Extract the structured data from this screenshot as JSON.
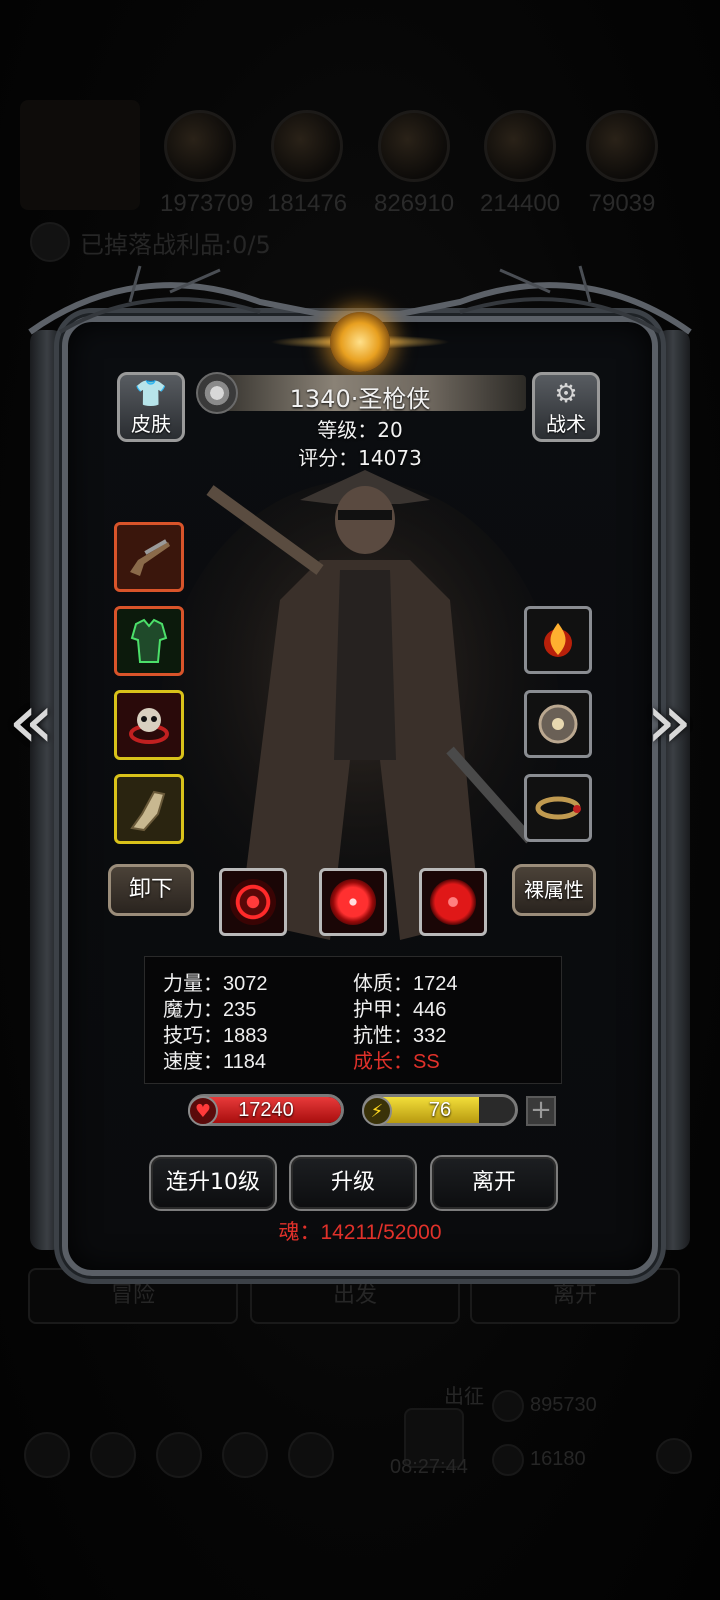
{
  "background": {
    "resources": [
      "1973709",
      "181476",
      "826910",
      "214400",
      "79039"
    ],
    "loot_text": "已掉落战利品:0/5",
    "bottom_buttons": [
      "冒险",
      "出发",
      "离开"
    ],
    "expedition_label": "出征",
    "gold": "895730",
    "gems": "16180",
    "clock": "08:27:44"
  },
  "hero": {
    "name": "1340·圣枪侠",
    "level_text": "等级：20",
    "score_text": "评分：14073"
  },
  "buttons": {
    "skin": "皮肤",
    "tactics": "战术",
    "unequip": "卸下",
    "bare_stats": "裸属性",
    "level_up_10": "连升10级",
    "level_up": "升级",
    "leave": "离开"
  },
  "equipment_left": [
    "rifle-slot",
    "armor-slot",
    "skull-ring-slot",
    "gauntlet-slot"
  ],
  "equipment_right": [
    "flame-rune-slot",
    "orb-slot",
    "bracelet-slot"
  ],
  "skills": [
    "crosshair-skill",
    "vortex-skill",
    "target-skill"
  ],
  "stats": {
    "strength": "力量：3072",
    "magic": "魔力：235",
    "skill": "技巧：1883",
    "speed": "速度：1184",
    "constitution": "体质：1724",
    "armor": "护甲：446",
    "resistance": "抗性：332",
    "growth": "成长：SS"
  },
  "bars": {
    "hp": "17240",
    "hp_fill": 1.0,
    "energy": "76",
    "energy_fill": 0.76
  },
  "soul_text": "魂：14211/52000",
  "colors": {
    "accent_red": "#e0312a",
    "hp_red": "#c81a1a",
    "energy_yellow": "#d9c21a"
  }
}
